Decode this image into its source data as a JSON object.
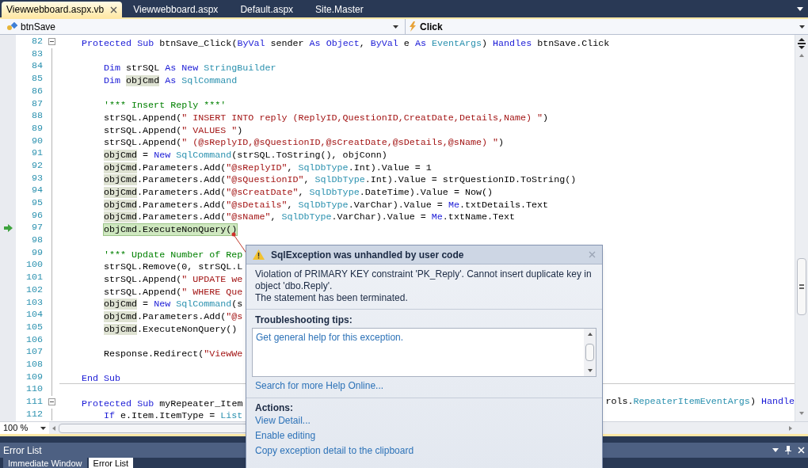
{
  "tabs": [
    {
      "label": "Viewwebboard.aspx.vb",
      "selected": true
    },
    {
      "label": "Viewwebboard.aspx",
      "selected": false
    },
    {
      "label": "Default.aspx",
      "selected": false
    },
    {
      "label": "Site.Master",
      "selected": false
    }
  ],
  "navigation": {
    "class_combo": "btnSave",
    "method_combo": "Click"
  },
  "editor": {
    "lines": [
      {
        "number": "82",
        "collapsible": true,
        "segments": [
          {
            "kind": "keyword",
            "text": "Protected Sub"
          },
          {
            "kind": "plain",
            "text": " btnSave_Click("
          },
          {
            "kind": "keyword",
            "text": "ByVal"
          },
          {
            "kind": "plain",
            "text": " sender "
          },
          {
            "kind": "keyword",
            "text": "As Object"
          },
          {
            "kind": "plain",
            "text": ", "
          },
          {
            "kind": "keyword",
            "text": "ByVal"
          },
          {
            "kind": "plain",
            "text": " e "
          },
          {
            "kind": "keyword",
            "text": "As "
          },
          {
            "kind": "type",
            "text": "EventArgs"
          },
          {
            "kind": "plain",
            "text": ") "
          },
          {
            "kind": "keyword",
            "text": "Handles"
          },
          {
            "kind": "plain",
            "text": " btnSave.Click"
          }
        ],
        "children": [
          {
            "number": "83"
          },
          {
            "number": "84",
            "segments": [
              {
                "kind": "keyword",
                "text": "Dim"
              },
              {
                "kind": "plain",
                "text": " strSQL "
              },
              {
                "kind": "keyword",
                "text": "As New "
              },
              {
                "kind": "type",
                "text": "StringBuilder"
              }
            ]
          },
          {
            "number": "85",
            "segments": [
              {
                "kind": "keyword",
                "text": "Dim "
              },
              {
                "kind": "ref",
                "text": "objCmd"
              },
              {
                "kind": "keyword",
                "text": " As "
              },
              {
                "kind": "type",
                "text": "SqlCommand"
              }
            ]
          },
          {
            "number": "86"
          },
          {
            "number": "87",
            "segments": [
              {
                "kind": "comment",
                "text": "'*** Insert Reply ***'"
              }
            ]
          },
          {
            "number": "88",
            "segments": [
              {
                "kind": "plain",
                "text": "strSQL.Append("
              },
              {
                "kind": "string",
                "text": "\" INSERT INTO reply (ReplyID,QuestionID,CreatDate,Details,Name) \""
              },
              {
                "kind": "plain",
                "text": ")"
              }
            ]
          },
          {
            "number": "89",
            "segments": [
              {
                "kind": "plain",
                "text": "strSQL.Append("
              },
              {
                "kind": "string",
                "text": "\" VALUES \""
              },
              {
                "kind": "plain",
                "text": ")"
              }
            ]
          },
          {
            "number": "90",
            "segments": [
              {
                "kind": "plain",
                "text": "strSQL.Append("
              },
              {
                "kind": "string",
                "text": "\" (@sReplyID,@sQuestionID,@sCreatDate,@sDetails,@sName) \""
              },
              {
                "kind": "plain",
                "text": ")"
              }
            ]
          },
          {
            "number": "91",
            "segments": [
              {
                "kind": "ref",
                "text": "objCmd"
              },
              {
                "kind": "plain",
                "text": " = "
              },
              {
                "kind": "keyword",
                "text": "New "
              },
              {
                "kind": "type",
                "text": "SqlCommand"
              },
              {
                "kind": "plain",
                "text": "(strSQL.ToString(), objConn)"
              }
            ]
          },
          {
            "number": "92",
            "segments": [
              {
                "kind": "ref",
                "text": "objCmd"
              },
              {
                "kind": "plain",
                "text": ".Parameters.Add("
              },
              {
                "kind": "string",
                "text": "\"@sReplyID\""
              },
              {
                "kind": "plain",
                "text": ", "
              },
              {
                "kind": "type",
                "text": "SqlDbType"
              },
              {
                "kind": "plain",
                "text": ".Int).Value = 1"
              }
            ]
          },
          {
            "number": "93",
            "segments": [
              {
                "kind": "ref",
                "text": "objCmd"
              },
              {
                "kind": "plain",
                "text": ".Parameters.Add("
              },
              {
                "kind": "string",
                "text": "\"@sQuestionID\""
              },
              {
                "kind": "plain",
                "text": ", "
              },
              {
                "kind": "type",
                "text": "SqlDbType"
              },
              {
                "kind": "plain",
                "text": ".Int).Value = strQuestionID.ToString()"
              }
            ]
          },
          {
            "number": "94",
            "segments": [
              {
                "kind": "ref",
                "text": "objCmd"
              },
              {
                "kind": "plain",
                "text": ".Parameters.Add("
              },
              {
                "kind": "string",
                "text": "\"@sCreatDate\""
              },
              {
                "kind": "plain",
                "text": ", "
              },
              {
                "kind": "type",
                "text": "SqlDbType"
              },
              {
                "kind": "plain",
                "text": ".DateTime).Value = Now()"
              }
            ]
          },
          {
            "number": "95",
            "segments": [
              {
                "kind": "ref",
                "text": "objCmd"
              },
              {
                "kind": "plain",
                "text": ".Parameters.Add("
              },
              {
                "kind": "string",
                "text": "\"@sDetails\""
              },
              {
                "kind": "plain",
                "text": ", "
              },
              {
                "kind": "type",
                "text": "SqlDbType"
              },
              {
                "kind": "plain",
                "text": ".VarChar).Value = "
              },
              {
                "kind": "keyword",
                "text": "Me"
              },
              {
                "kind": "plain",
                "text": ".txtDetails.Text"
              }
            ]
          },
          {
            "number": "96",
            "segments": [
              {
                "kind": "ref",
                "text": "objCmd"
              },
              {
                "kind": "plain",
                "text": ".Parameters.Add("
              },
              {
                "kind": "string",
                "text": "\"@sName\""
              },
              {
                "kind": "plain",
                "text": ", "
              },
              {
                "kind": "type",
                "text": "SqlDbType"
              },
              {
                "kind": "plain",
                "text": ".VarChar).Value = "
              },
              {
                "kind": "keyword",
                "text": "Me"
              },
              {
                "kind": "plain",
                "text": ".txtName.Text"
              }
            ]
          },
          {
            "number": "97",
            "current": true,
            "segments": [
              {
                "kind": "plain",
                "text": "objCmd.ExecuteNonQuery()"
              }
            ]
          },
          {
            "number": "98"
          },
          {
            "number": "99",
            "segments": [
              {
                "kind": "comment",
                "text": "'*** Update Number of Rep"
              }
            ]
          },
          {
            "number": "100",
            "segments": [
              {
                "kind": "plain",
                "text": "strSQL.Remove(0, strSQL.L"
              }
            ]
          },
          {
            "number": "101",
            "segments": [
              {
                "kind": "plain",
                "text": "strSQL.Append("
              },
              {
                "kind": "string",
                "text": "\" UPDATE we"
              }
            ]
          },
          {
            "number": "102",
            "segments": [
              {
                "kind": "plain",
                "text": "strSQL.Append("
              },
              {
                "kind": "string",
                "text": "\" WHERE Que"
              }
            ]
          },
          {
            "number": "103",
            "segments": [
              {
                "kind": "ref",
                "text": "objCmd"
              },
              {
                "kind": "plain",
                "text": " = "
              },
              {
                "kind": "keyword",
                "text": "New "
              },
              {
                "kind": "type",
                "text": "SqlCommand"
              },
              {
                "kind": "plain",
                "text": "(s"
              }
            ]
          },
          {
            "number": "104",
            "segments": [
              {
                "kind": "ref",
                "text": "objCmd"
              },
              {
                "kind": "plain",
                "text": ".Parameters.Add("
              },
              {
                "kind": "string",
                "text": "\"@s"
              }
            ]
          },
          {
            "number": "105",
            "segments": [
              {
                "kind": "ref",
                "text": "objCmd"
              },
              {
                "kind": "plain",
                "text": ".ExecuteNonQuery()"
              }
            ]
          },
          {
            "number": "106"
          },
          {
            "number": "107",
            "segments": [
              {
                "kind": "plain",
                "text": "Response.Redirect("
              },
              {
                "kind": "string",
                "text": "\"ViewWe"
              }
            ]
          },
          {
            "number": "108"
          }
        ]
      },
      {
        "number": "109",
        "segments": [
          {
            "kind": "keyword",
            "text": "End Sub"
          }
        ]
      },
      {
        "number": "110",
        "separator_above": true
      },
      {
        "number": "111",
        "collapsible": true,
        "segments": [
          {
            "kind": "keyword",
            "text": "Protected Sub"
          },
          {
            "kind": "plain",
            "text": " myRepeater_Item"
          }
        ],
        "right_segments": [
          {
            "kind": "plain",
            "text": "rols."
          },
          {
            "kind": "type",
            "text": "RepeaterItemEventArgs"
          },
          {
            "kind": "plain",
            "text": ") "
          },
          {
            "kind": "keyword",
            "text": "Handle"
          }
        ],
        "children": [
          {
            "number": "112",
            "segments": [
              {
                "kind": "keyword",
                "text": "If"
              },
              {
                "kind": "plain",
                "text": " e.Item.ItemType = "
              },
              {
                "kind": "type",
                "text": "List"
              }
            ]
          }
        ]
      }
    ],
    "zoom": "100 %"
  },
  "exception_helper": {
    "title": "SqlException was unhandled by user code",
    "message": [
      "Violation of PRIMARY KEY constraint 'PK_Reply'. Cannot insert duplicate key in object 'dbo.Reply'.",
      "The statement has been terminated."
    ],
    "tips_heading": "Troubleshooting tips:",
    "tips": [
      "Get general help for this exception."
    ],
    "search_link": "Search for more Help Online...",
    "actions_heading": "Actions:",
    "actions": [
      "View Detail...",
      "Enable editing",
      "Copy exception detail to the clipboard"
    ]
  },
  "bottom_panel": {
    "title": "Error List",
    "tabs": [
      {
        "label": "Immediate Window",
        "selected": false
      },
      {
        "label": "Error List",
        "selected": true
      }
    ]
  }
}
